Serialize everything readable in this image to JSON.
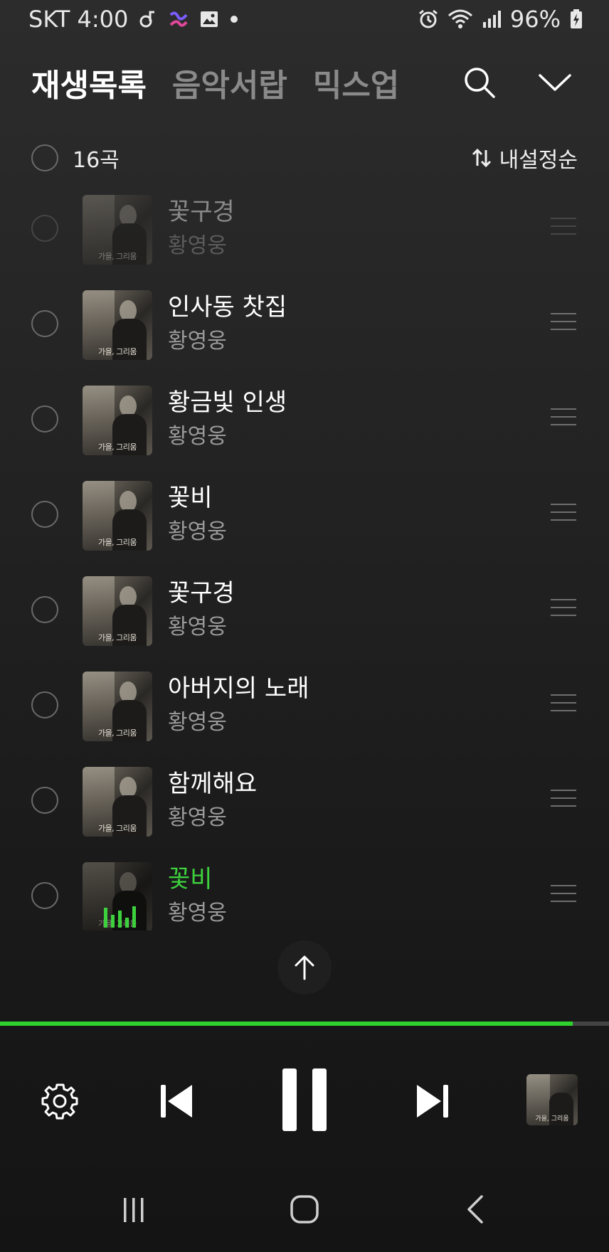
{
  "status_bar": {
    "carrier_time": "SKT 4:00",
    "notif_icons": [
      "music-note-icon",
      "app-notification-icon",
      "gallery-icon",
      "dot-icon"
    ],
    "battery": "96%",
    "right_icons": [
      "alarm-icon",
      "wifi-icon",
      "signal-icon",
      "battery-charging-icon"
    ]
  },
  "tabs": [
    {
      "label": "재생목록",
      "active": true
    },
    {
      "label": "음악서랍",
      "active": false
    },
    {
      "label": "믹스업",
      "active": false
    }
  ],
  "list_header": {
    "count": "16곡",
    "sort_label": "내설정순"
  },
  "album_caption": "가을, 그리움",
  "tracks": [
    {
      "title": "꽃구경",
      "artist": "황영웅",
      "faded": true
    },
    {
      "title": "인사동 찻집",
      "artist": "황영웅"
    },
    {
      "title": "황금빛 인생",
      "artist": "황영웅"
    },
    {
      "title": "꽃비",
      "artist": "황영웅"
    },
    {
      "title": "꽃구경",
      "artist": "황영웅"
    },
    {
      "title": "아버지의 노래",
      "artist": "황영웅"
    },
    {
      "title": "함께해요",
      "artist": "황영웅"
    },
    {
      "title": "꽃비",
      "artist": "황영웅",
      "playing": true
    }
  ],
  "player": {
    "progress_fraction": 0.94,
    "mini_cover_caption": "가을, 그리움"
  },
  "colors": {
    "accent": "#2fd12f",
    "playing_title": "#3ed13e",
    "background": "#1f1f1f"
  }
}
